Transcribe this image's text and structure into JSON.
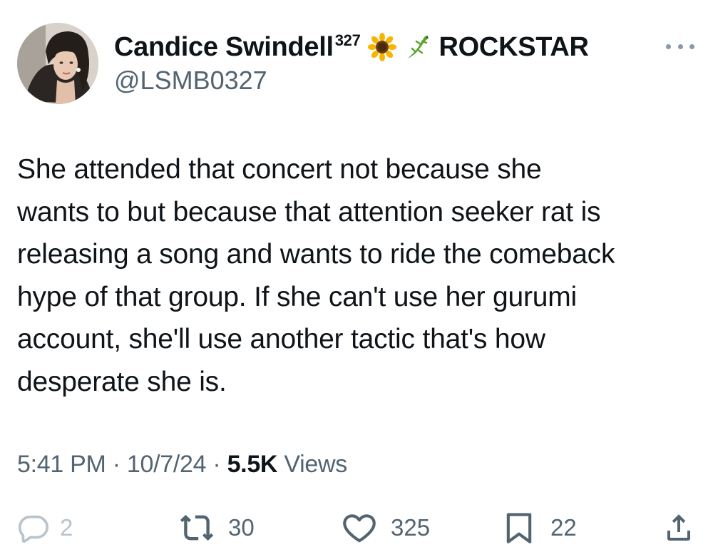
{
  "author": {
    "display_name": "Candice Swindell",
    "name_superscript": "327",
    "emoji_1": "sunflower-emoji",
    "emoji_2": "lizard-emoji",
    "name_suffix": "ROCKSTAR",
    "handle": "@LSMB0327",
    "avatar": "profile-photo"
  },
  "tweet": {
    "lines": [
      "She attended that concert not because she",
      "wants to but because that attention seeker rat is",
      "releasing a song and wants to ride the comeback",
      "hype of that group. If she can't use her gurumi",
      "account, she'll use another tactic that's how",
      "desperate she is."
    ]
  },
  "meta": {
    "time": "5:41 PM",
    "separator": "·",
    "date": "10/7/24",
    "views_count": "5.5K",
    "views_label": "Views"
  },
  "actions": {
    "replies": "2",
    "reposts": "30",
    "likes": "325",
    "bookmarks": "22"
  },
  "colors": {
    "text_primary": "#0f1419",
    "text_secondary": "#536471",
    "icon": "#536471",
    "reply_faded": "#b9c3cc"
  }
}
